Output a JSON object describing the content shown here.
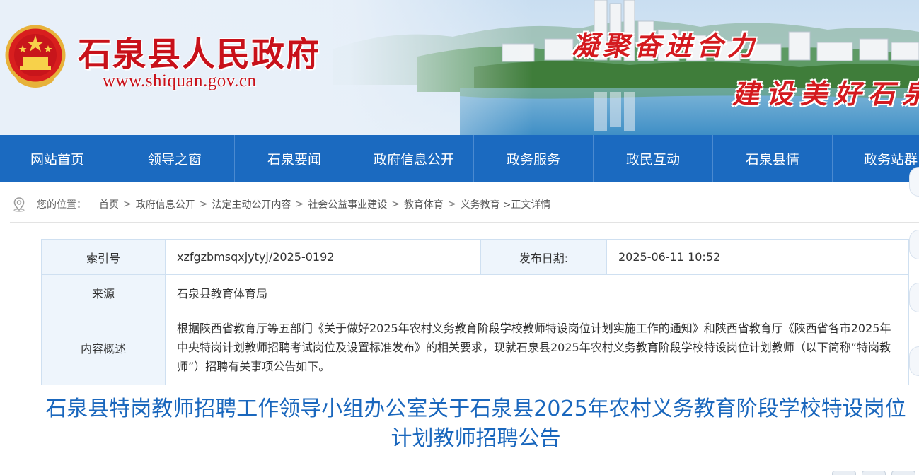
{
  "header": {
    "site_title": "石泉县人民政府",
    "site_url": "www.shiquan.gov.cn",
    "slogan_line1": "凝聚奋进合力",
    "slogan_line2": "建设美好石泉",
    "emblem_icon": "national-emblem-icon",
    "colors": {
      "title_red": "#c8111a",
      "nav_blue": "#1b6ac0",
      "title_blue": "#1a67bd"
    }
  },
  "nav": {
    "items": [
      {
        "label": "网站首页"
      },
      {
        "label": "领导之窗"
      },
      {
        "label": "石泉要闻"
      },
      {
        "label": "政府信息公开"
      },
      {
        "label": "政务服务"
      },
      {
        "label": "政民互动"
      },
      {
        "label": "石泉县情"
      },
      {
        "label": "政务站群"
      }
    ]
  },
  "breadcrumb": {
    "label": "您的位置：",
    "icon": "location-pin-icon",
    "items": [
      "首页",
      "政府信息公开",
      "法定主动公开内容",
      "社会公益事业建设",
      "教育体育",
      "义务教育"
    ],
    "current": ">正文详情"
  },
  "info": {
    "index_label": "索引号",
    "index_value": "xzfgzbmsqxjytyj/2025-0192",
    "date_label": "发布日期:",
    "date_value": "2025-06-11 10:52",
    "source_label": "来源",
    "source_value": "石泉县教育体育局",
    "summary_label": "内容概述",
    "summary_value": "根据陕西省教育厅等五部门《关于做好2025年农村义务教育阶段学校教师特设岗位计划实施工作的通知》和陕西省教育厅《陕西省各市2025年中央特岗计划教师招聘考试岗位及设置标准发布》的相关要求，现就石泉县2025年农村义务教育阶段学校特设岗位计划教师（以下简称“特岗教师”）招聘有关事项公告如下。"
  },
  "article": {
    "title": "石泉县特岗教师招聘工作领导小组办公室关于石泉县2025年农村义务教育阶段学校特设岗位计划教师招聘公告"
  }
}
